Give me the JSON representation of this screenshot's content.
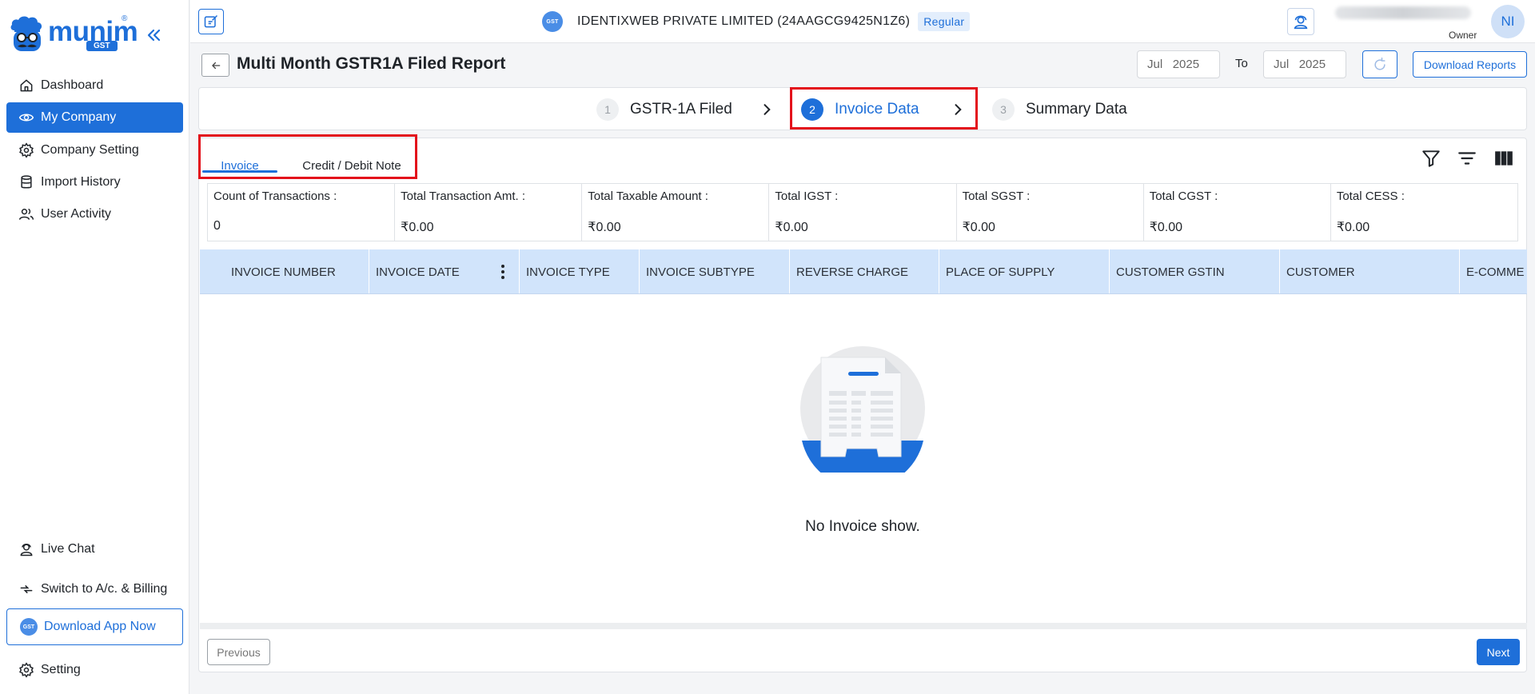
{
  "brand": {
    "name": "munim",
    "sub": "GST",
    "reg": "®"
  },
  "sidebar": {
    "items": [
      {
        "label": "Dashboard",
        "icon": "home-icon"
      },
      {
        "label": "My Company",
        "icon": "eye-icon",
        "active": true
      },
      {
        "label": "Company Setting",
        "icon": "gear-icon"
      },
      {
        "label": "Import History",
        "icon": "database-icon"
      },
      {
        "label": "User Activity",
        "icon": "users-icon"
      }
    ],
    "bottom": {
      "live_chat": "Live Chat",
      "switch": "Switch to A/c. & Billing",
      "download_app": "Download App Now",
      "setting": "Setting"
    }
  },
  "header": {
    "company": "IDENTIXWEB PRIVATE LIMITED (24AAGCG9425N1Z6)",
    "badge": "Regular",
    "role": "Owner",
    "avatar_initials": "NI",
    "gst_badge_text": "GST"
  },
  "page": {
    "title": "Multi Month GSTR1A Filed Report",
    "from_month": "Jul",
    "from_year": "2025",
    "to_label": "To",
    "to_month": "Jul",
    "to_year": "2025",
    "download_reports": "Download Reports"
  },
  "steps": [
    {
      "num": "1",
      "label": "GSTR-1A Filed",
      "active": false
    },
    {
      "num": "2",
      "label": "Invoice Data",
      "active": true
    },
    {
      "num": "3",
      "label": "Summary Data",
      "active": false
    }
  ],
  "tabs": [
    {
      "label": "Invoice",
      "active": true
    },
    {
      "label": "Credit / Debit Note",
      "active": false
    }
  ],
  "summary": [
    {
      "label": "Count of Transactions :",
      "value": "0"
    },
    {
      "label": "Total Transaction Amt. :",
      "value": "₹0.00"
    },
    {
      "label": "Total Taxable Amount :",
      "value": "₹0.00"
    },
    {
      "label": "Total IGST :",
      "value": "₹0.00"
    },
    {
      "label": "Total SGST :",
      "value": "₹0.00"
    },
    {
      "label": "Total CGST :",
      "value": "₹0.00"
    },
    {
      "label": "Total CESS :",
      "value": "₹0.00"
    }
  ],
  "table": {
    "columns": [
      "INVOICE NUMBER",
      "INVOICE DATE",
      "INVOICE TYPE",
      "INVOICE SUBTYPE",
      "REVERSE CHARGE",
      "PLACE OF SUPPLY",
      "CUSTOMER GSTIN",
      "CUSTOMER",
      "E-COMME"
    ],
    "empty_text": "No Invoice show."
  },
  "pagination": {
    "previous": "Previous",
    "next": "Next"
  },
  "colors": {
    "accent": "#1e6fd9",
    "header_bg": "#d1e4fb",
    "highlight": "#e3101b"
  }
}
